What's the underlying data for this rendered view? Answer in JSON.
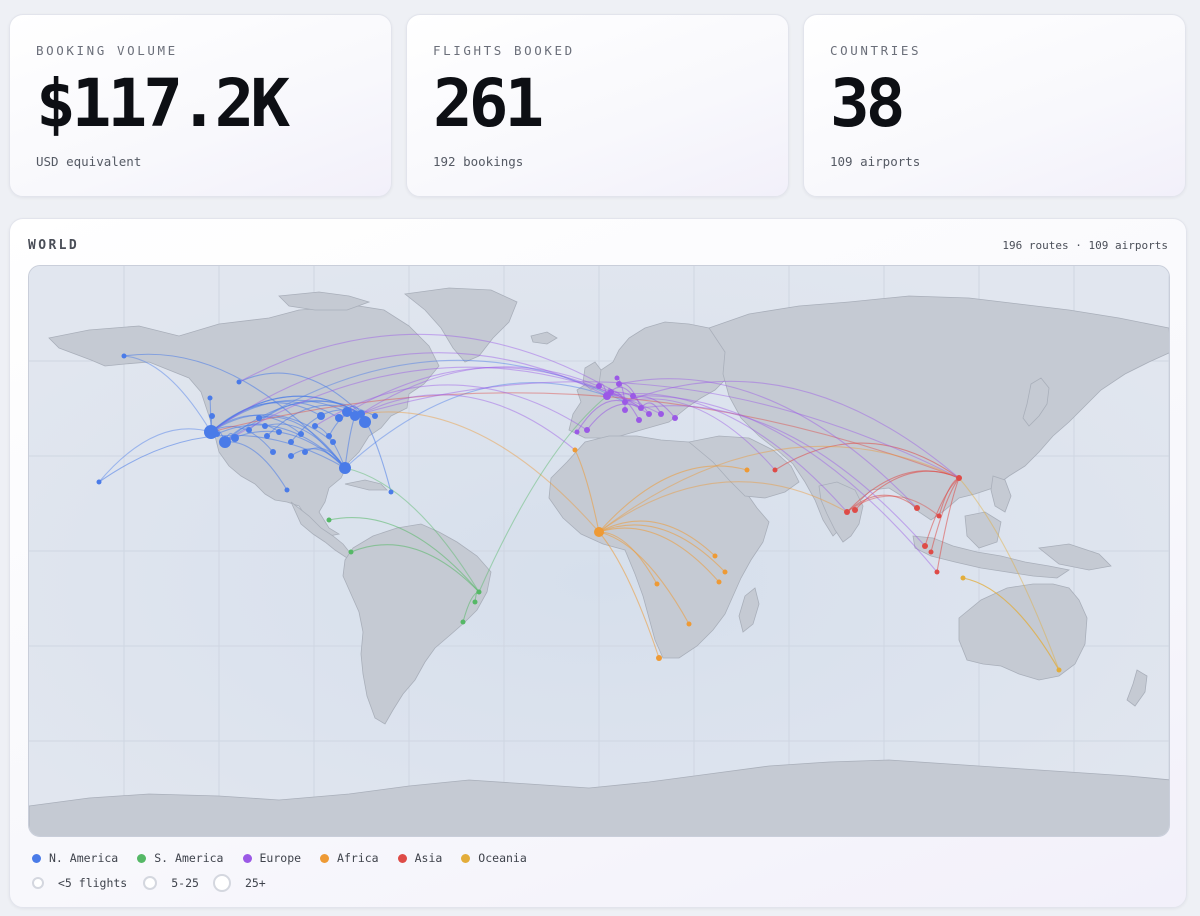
{
  "stats": [
    {
      "label": "BOOKING VOLUME",
      "value": "$117.2K",
      "sub": "USD equivalent"
    },
    {
      "label": "FLIGHTS BOOKED",
      "value": "261",
      "sub": "192 bookings"
    },
    {
      "label": "COUNTRIES",
      "value": "38",
      "sub": "109 airports"
    }
  ],
  "world": {
    "title": "WORLD",
    "meta": "196 routes · 109 airports"
  },
  "regions": [
    {
      "name": "N. America",
      "color": "#4a7be8"
    },
    {
      "name": "S. America",
      "color": "#55b866"
    },
    {
      "name": "Europe",
      "color": "#9b59e6"
    },
    {
      "name": "Africa",
      "color": "#ee9a35"
    },
    {
      "name": "Asia",
      "color": "#de4b47"
    },
    {
      "name": "Oceania",
      "color": "#e3ad3a"
    }
  ],
  "size_legend": [
    "<5 flights",
    "5-25",
    "25+"
  ]
}
